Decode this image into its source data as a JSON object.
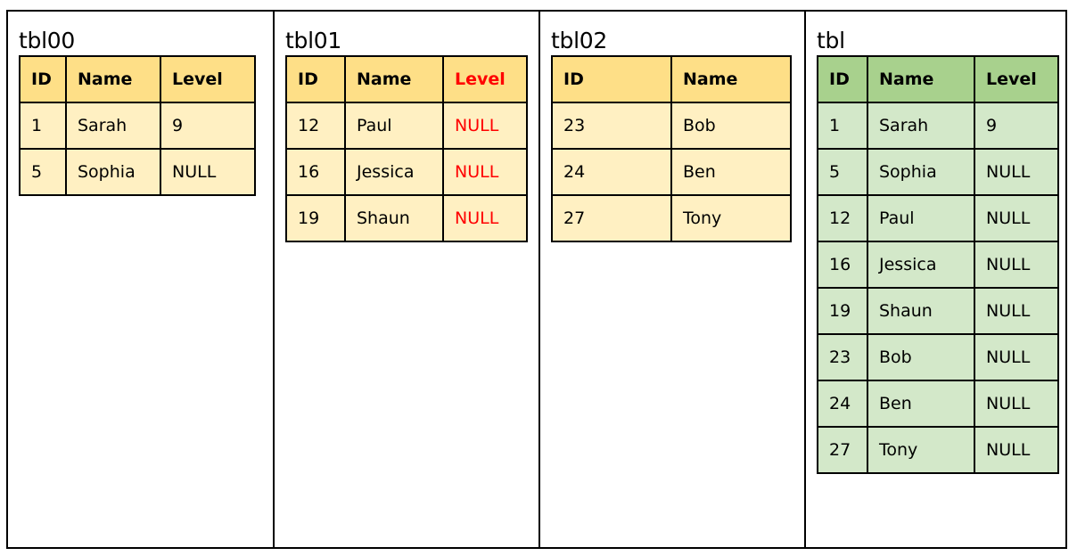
{
  "tables": [
    {
      "name": "tbl00",
      "headers": [
        "ID",
        "Name",
        "Level"
      ],
      "rows": [
        [
          "1",
          "Sarah",
          "9"
        ],
        [
          "5",
          "Sophia",
          "NULL"
        ]
      ]
    },
    {
      "name": "tbl01",
      "headers": [
        "ID",
        "Name",
        "Level"
      ],
      "rows": [
        [
          "12",
          "Paul",
          "NULL"
        ],
        [
          "16",
          "Jessica",
          "NULL"
        ],
        [
          "19",
          "Shaun",
          "NULL"
        ]
      ]
    },
    {
      "name": "tbl02",
      "headers": [
        "ID",
        "Name"
      ],
      "rows": [
        [
          "23",
          "Bob"
        ],
        [
          "24",
          "Ben"
        ],
        [
          "27",
          "Tony"
        ]
      ]
    },
    {
      "name": "tbl",
      "headers": [
        "ID",
        "Name",
        "Level"
      ],
      "rows": [
        [
          "1",
          "Sarah",
          "9"
        ],
        [
          "5",
          "Sophia",
          "NULL"
        ],
        [
          "12",
          "Paul",
          "NULL"
        ],
        [
          "16",
          "Jessica",
          "NULL"
        ],
        [
          "19",
          "Shaun",
          "NULL"
        ],
        [
          "23",
          "Bob",
          "NULL"
        ],
        [
          "24",
          "Ben",
          "NULL"
        ],
        [
          "27",
          "Tony",
          "NULL"
        ]
      ]
    }
  ],
  "colors": {
    "source_header": "#fedf87",
    "source_cell": "#fff0c2",
    "result_header": "#a8d18d",
    "result_cell": "#d3e8c9",
    "highlight_text": "#ff0000"
  }
}
